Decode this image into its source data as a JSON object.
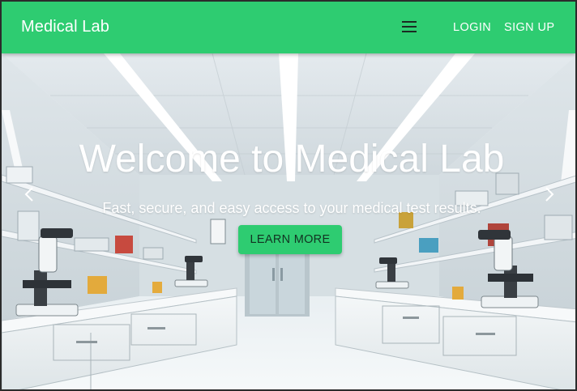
{
  "navbar": {
    "brand": "Medical Lab",
    "menu_icon": "hamburger-menu-icon",
    "links": [
      "LOGIN",
      "SIGN UP"
    ],
    "color": "#2ecc71"
  },
  "hero": {
    "title": "Welcome to Medical Lab",
    "subtitle": "Fast, secure, and easy access to your medical test results.",
    "cta_label": "LEARN MORE",
    "prev_icon": "chevron-left-icon",
    "next_icon": "chevron-right-icon",
    "background": "laboratory-photo"
  }
}
